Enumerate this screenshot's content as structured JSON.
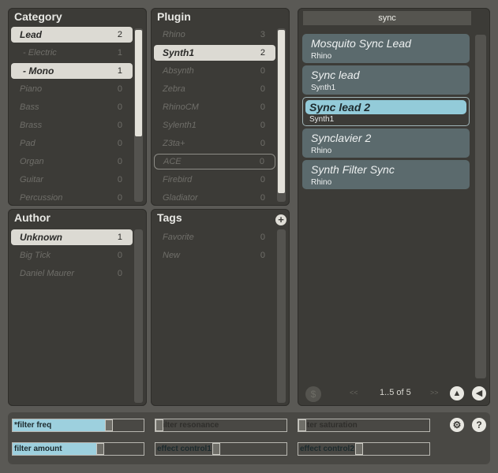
{
  "category": {
    "title": "Category",
    "items": [
      {
        "label": "Lead",
        "count": "2"
      },
      {
        "label": "- Electric",
        "count": "1"
      },
      {
        "label": "- Mono",
        "count": "1"
      },
      {
        "label": "Piano",
        "count": "0"
      },
      {
        "label": "Bass",
        "count": "0"
      },
      {
        "label": "Brass",
        "count": "0"
      },
      {
        "label": "Pad",
        "count": "0"
      },
      {
        "label": "Organ",
        "count": "0"
      },
      {
        "label": "Guitar",
        "count": "0"
      },
      {
        "label": "Percussion",
        "count": "0"
      }
    ]
  },
  "plugin": {
    "title": "Plugin",
    "items": [
      {
        "label": "Rhino",
        "count": "3"
      },
      {
        "label": "Synth1",
        "count": "2"
      },
      {
        "label": "Absynth",
        "count": "0"
      },
      {
        "label": "Zebra",
        "count": "0"
      },
      {
        "label": "RhinoCM",
        "count": "0"
      },
      {
        "label": "Sylenth1",
        "count": "0"
      },
      {
        "label": "Z3ta+",
        "count": "0"
      },
      {
        "label": "ACE",
        "count": "0"
      },
      {
        "label": "Firebird",
        "count": "0"
      },
      {
        "label": "Gladiator",
        "count": "0"
      }
    ]
  },
  "author": {
    "title": "Author",
    "items": [
      {
        "label": "Unknown",
        "count": "1"
      },
      {
        "label": "Big Tick",
        "count": "0"
      },
      {
        "label": "Daniel Maurer",
        "count": "0"
      }
    ]
  },
  "tags": {
    "title": "Tags",
    "add_icon": "plus-icon",
    "add_glyph": "+",
    "items": [
      {
        "label": "Favorite",
        "count": "0"
      },
      {
        "label": "New",
        "count": "0"
      }
    ]
  },
  "results": {
    "search_value": "sync",
    "items": [
      {
        "name": "Mosquito Sync Lead",
        "plugin": "Rhino"
      },
      {
        "name": "Sync lead",
        "plugin": "Synth1"
      },
      {
        "name": "Sync lead 2",
        "plugin": "Synth1"
      },
      {
        "name": "Synclavier 2",
        "plugin": "Rhino"
      },
      {
        "name": "Synth Filter Sync",
        "plugin": "Rhino"
      }
    ],
    "prev_label": "<<",
    "next_label": ">>",
    "pager_text": "1..5 of 5",
    "dollar_glyph": "$",
    "up_glyph": "▲",
    "back_glyph": "◀"
  },
  "controls": {
    "sliders": [
      {
        "label": "*filter freq",
        "value": 0.75
      },
      {
        "label": "*filter resonance",
        "value": 0.0
      },
      {
        "label": "filter saturation",
        "value": 0.0
      },
      {
        "label": "filter amount",
        "value": 0.68
      },
      {
        "label": "effect control1",
        "value": 0.46
      },
      {
        "label": "effect control2",
        "value": 0.46
      }
    ],
    "settings_glyph": "⚙",
    "help_glyph": "?"
  },
  "colors": {
    "accent": "#9dd0de",
    "panel": "#3c3b37",
    "background": "#5a5955",
    "selected_row": "#dcdad3",
    "card": "#5b6a6d"
  }
}
